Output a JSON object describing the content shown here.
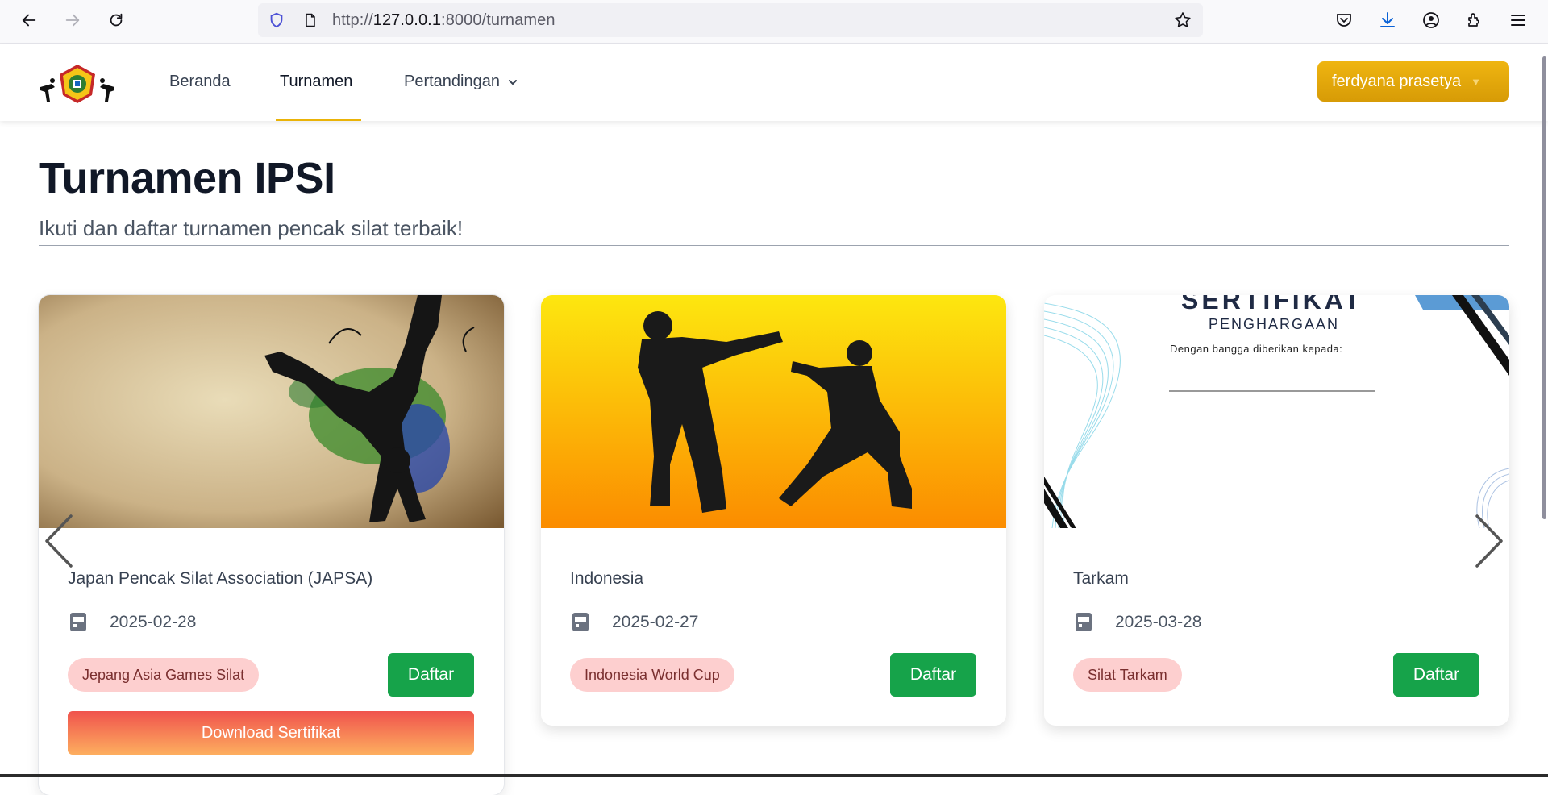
{
  "browser": {
    "url_prefix": "http://",
    "url_host": "127.0.0.1",
    "url_path": ":8000/turnamen"
  },
  "nav": {
    "items": [
      {
        "label": "Beranda"
      },
      {
        "label": "Turnamen"
      },
      {
        "label": "Pertandingan"
      }
    ],
    "user_label": "ferdyana prasetya"
  },
  "header": {
    "title": "Turnamen IPSI",
    "subtitle": "Ikuti dan daftar turnamen pencak silat terbaik!"
  },
  "cards": [
    {
      "title": "Japan Pencak Silat Association (JAPSA)",
      "date": "2025-02-28",
      "tag": "Jepang Asia Games Silat",
      "register_label": "Daftar",
      "certificate_label": "Download Sertifikat"
    },
    {
      "title": "Indonesia",
      "date": "2025-02-27",
      "tag": "Indonesia World Cup",
      "register_label": "Daftar"
    },
    {
      "title": "Tarkam",
      "date": "2025-03-28",
      "tag": "Silat Tarkam",
      "register_label": "Daftar",
      "image_text": {
        "heading": "SERTIFIKAT",
        "subheading": "PENGHARGAAN",
        "line": "Dengan bangga diberikan kepada:"
      }
    }
  ],
  "colors": {
    "accent": "#eab308",
    "register": "#16a34a",
    "tag_bg": "#fdcfcf",
    "user_btn": "#d99e07"
  }
}
